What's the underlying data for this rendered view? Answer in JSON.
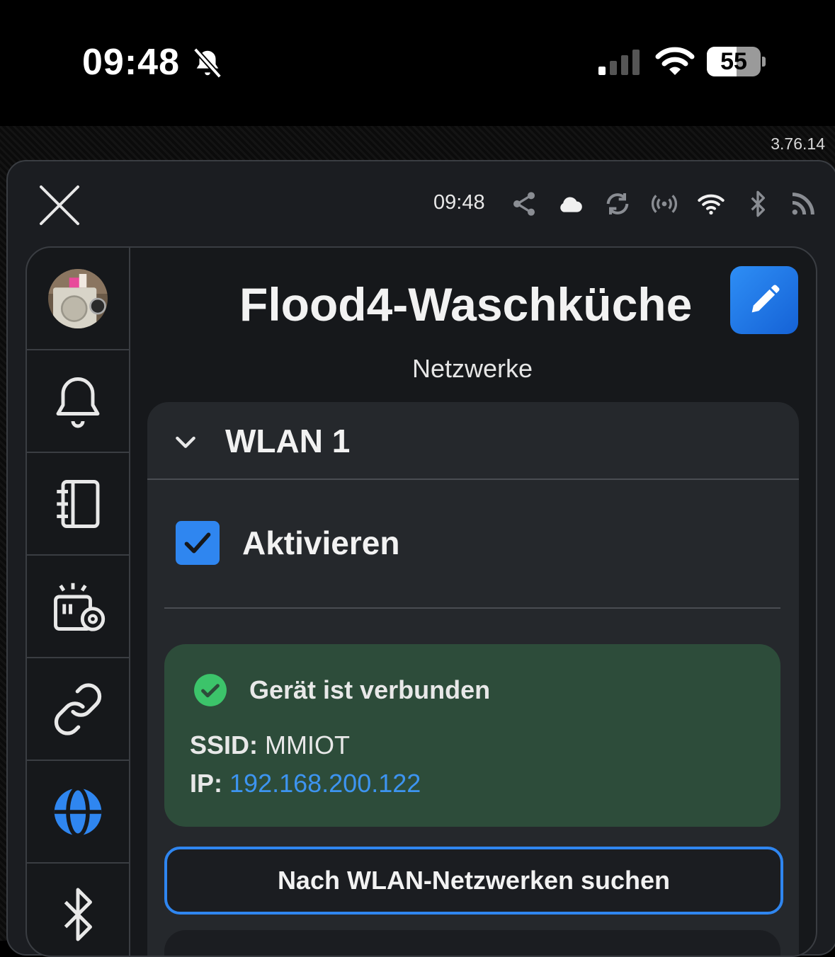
{
  "status_bar": {
    "time": "09:48",
    "battery": "55",
    "battery_level": 0.55
  },
  "version": "3.76.14",
  "topbar": {
    "time": "09:48"
  },
  "device": {
    "title": "Flood4-Waschküche",
    "subtitle": "Netzwerke"
  },
  "wlan": {
    "title": "WLAN 1",
    "activate_label": "Aktivieren",
    "activate_checked": true,
    "status_text": "Gerät ist verbunden",
    "ssid_label": "SSID:",
    "ssid_value": "MMIOT",
    "ip_label": "IP:",
    "ip_value": "192.168.200.122",
    "scan_button": "Nach WLAN-Netzwerken suchen"
  },
  "colors": {
    "accent": "#2f86f0",
    "success_bg": "#2d4c3a",
    "success_icon": "#3cc46a",
    "link": "#3d94f0"
  },
  "icons": {
    "topbar": [
      "share-icon",
      "cloud-icon",
      "sync-icon",
      "broadcast-icon",
      "wifi-icon",
      "bluetooth-icon",
      "rss-icon"
    ],
    "sidebar": [
      "avatar",
      "bell-icon",
      "notebook-icon",
      "device-settings-icon",
      "link-icon",
      "globe-icon",
      "bluetooth-icon"
    ]
  }
}
